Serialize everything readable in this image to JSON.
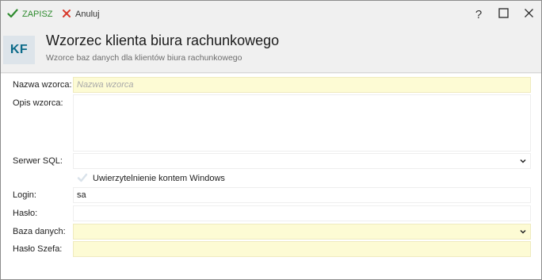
{
  "toolbar": {
    "save_label": "ZAPISZ",
    "cancel_label": "Anuluj",
    "help_label": "?"
  },
  "header": {
    "badge": "KF",
    "title": "Wzorzec klienta biura rachunkowego",
    "subtitle": "Wzorce baz danych dla klientów biura rachunkowego"
  },
  "form": {
    "name": {
      "label": "Nazwa wzorca:",
      "placeholder": "Nazwa wzorca",
      "value": ""
    },
    "description": {
      "label": "Opis wzorca:",
      "value": ""
    },
    "sql_server": {
      "label": "Serwer SQL:",
      "value": ""
    },
    "windows_auth": {
      "label": "Uwierzytelnienie kontem Windows",
      "checked": false
    },
    "login": {
      "label": "Login:",
      "value": "sa"
    },
    "password": {
      "label": "Hasło:",
      "value": ""
    },
    "database": {
      "label": "Baza danych:",
      "value": ""
    },
    "chief_password": {
      "label": "Hasło Szefa:",
      "value": ""
    }
  },
  "colors": {
    "save_accent": "#2e8b2e",
    "cancel_accent": "#d83a2c",
    "badge_text": "#0b6a89",
    "badge_bg": "#dde4ea",
    "required_field_bg": "#fdfbd4"
  },
  "icons": {
    "save": "check-icon",
    "cancel": "x-icon",
    "help": "question-icon",
    "maximize": "maximize-icon",
    "close": "close-icon",
    "dropdown": "chevron-down-icon",
    "checkbox": "checkbox-icon"
  }
}
